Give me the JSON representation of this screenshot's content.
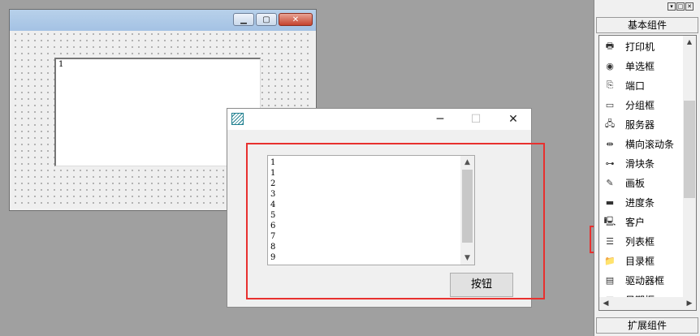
{
  "designer": {
    "list_items": [
      "1"
    ]
  },
  "runtime_window": {
    "controls": {
      "minimize": "─",
      "maximize": "☐",
      "close": "✕"
    },
    "list_items": [
      "1",
      "1",
      "2",
      "3",
      "4",
      "5",
      "6",
      "7",
      "8",
      "9"
    ],
    "button_label": "按钮"
  },
  "palette": {
    "basic_header": "基本组件",
    "ext_header": "扩展组件",
    "items": [
      {
        "label": "打印机",
        "icon": "printer-icon"
      },
      {
        "label": "单选框",
        "icon": "radio-icon"
      },
      {
        "label": "端口",
        "icon": "port-icon"
      },
      {
        "label": "分组框",
        "icon": "groupbox-icon"
      },
      {
        "label": "服务器",
        "icon": "server-icon"
      },
      {
        "label": "横向滚动条",
        "icon": "hscroll-icon"
      },
      {
        "label": "滑块条",
        "icon": "slider-icon"
      },
      {
        "label": "画板",
        "icon": "canvas-icon"
      },
      {
        "label": "进度条",
        "icon": "progress-icon"
      },
      {
        "label": "客户",
        "icon": "client-icon"
      },
      {
        "label": "列表框",
        "icon": "listbox-icon"
      },
      {
        "label": "目录框",
        "icon": "dir-icon"
      },
      {
        "label": "驱动器框",
        "icon": "drive-icon"
      },
      {
        "label": "日期框",
        "icon": "date-icon"
      }
    ]
  }
}
